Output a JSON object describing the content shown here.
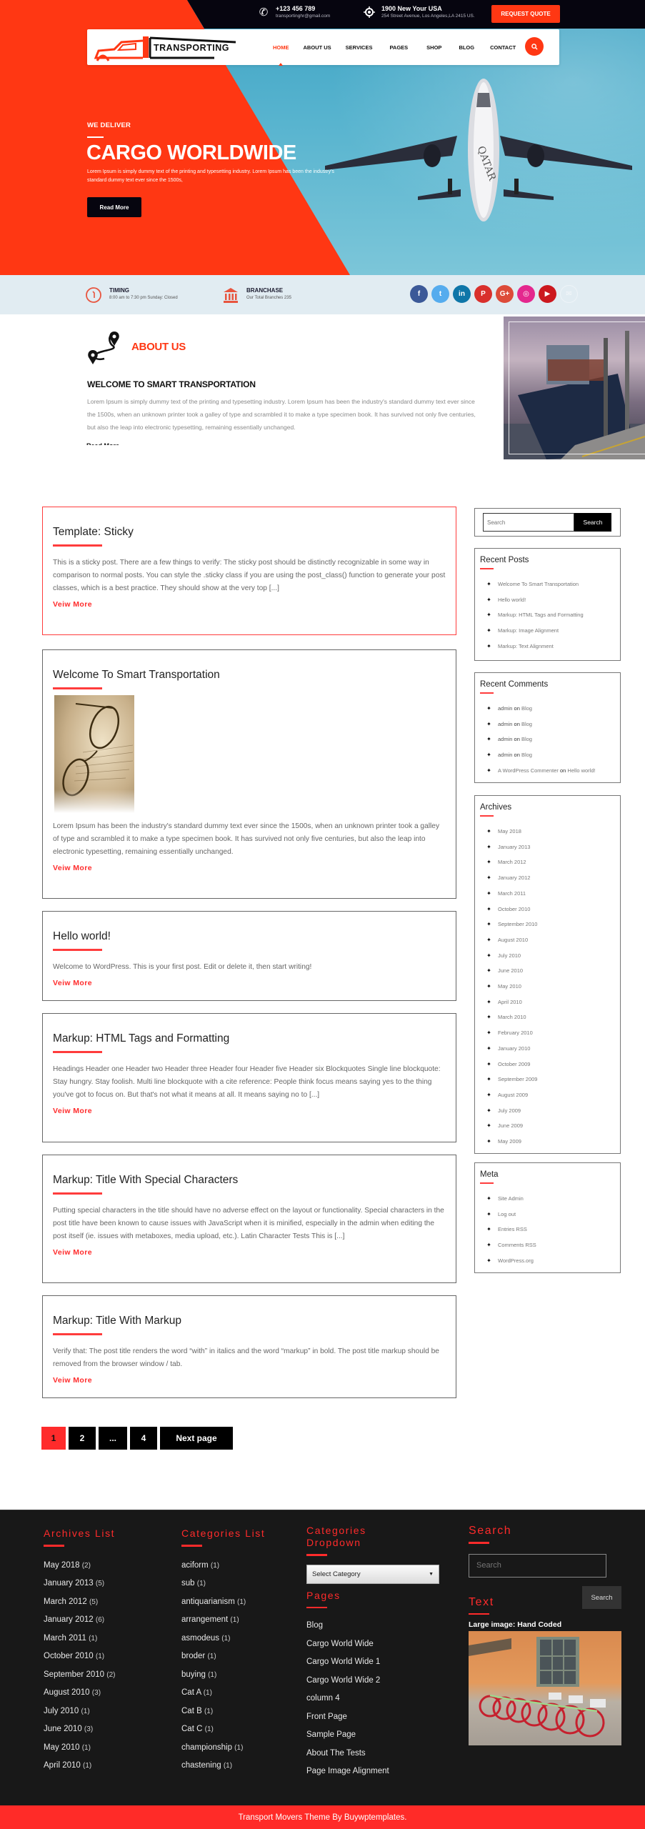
{
  "topbar": {
    "phone": "+123 456 789",
    "email": "transportinghr@gmail.com",
    "address_title": "1900 New Your USA",
    "address_line": "254 Street Avenue, Los Angeles,LA 2415 US.",
    "quote_button": "REQUEST QUOTE"
  },
  "brand": {
    "name": "TRANSPORTING"
  },
  "nav": {
    "items": [
      {
        "label": "HOME",
        "active": true
      },
      {
        "label": "ABOUT US"
      },
      {
        "label": "SERVICES"
      },
      {
        "label": "PAGES"
      },
      {
        "label": "SHOP"
      },
      {
        "label": "BLOG"
      },
      {
        "label": "CONTACT"
      }
    ]
  },
  "hero": {
    "tag": "WE DELIVER",
    "title": "CARGO WORLDWIDE",
    "description": "Lorem Ipsum is simply dummy text of the printing and typesetting industry. Lorem Ipsum has been the industry's standard dummy text ever since the 1500s,",
    "button": "Read More"
  },
  "info": {
    "timing_title": "TIMING",
    "timing_text": "8:00 am to 7:30 pm  Sunday: Closed",
    "branch_title": "BRANCHASE",
    "branch_text": "Our Total Branches 235",
    "socials": [
      {
        "name": "facebook",
        "glyph": "f",
        "color": "#3b5998"
      },
      {
        "name": "twitter",
        "glyph": "t",
        "color": "#55acee"
      },
      {
        "name": "linkedin",
        "glyph": "in",
        "color": "#0e76a8"
      },
      {
        "name": "pinterest",
        "glyph": "P",
        "color": "#d9302c"
      },
      {
        "name": "google-plus",
        "glyph": "G+",
        "color": "#dd4b39"
      },
      {
        "name": "instagram",
        "glyph": "◎",
        "color": "#e4288e"
      },
      {
        "name": "youtube",
        "glyph": "▶",
        "color": "#cc181e"
      },
      {
        "name": "email",
        "glyph": "✉",
        "color": "#e1ecf2"
      }
    ]
  },
  "about": {
    "title": "ABOUT US",
    "subtitle": "WELCOME TO SMART TRANSPORTATION",
    "text": "Lorem Ipsum is simply dummy text of the printing and typesetting industry. Lorem Ipsum has been the industry's standard dummy text ever since the 1500s, when an unknown printer took a galley of type and scrambled it to make a type specimen book. It has survived not only five centuries, but also the leap into electronic typesetting, remaining essentially unchanged.",
    "more": "Read More →"
  },
  "posts": [
    {
      "title": "Template: Sticky",
      "excerpt": "This is a sticky post. There are a few things to verify: The sticky post should be distinctly recognizable in some way in comparison to normal posts. You can style the .sticky class if you are using the post_class() function to generate your post classes, which is a best practice. They should show at the very top [...]",
      "more": "Veiw More",
      "sticky": true
    },
    {
      "title": "Welcome To Smart Transportation",
      "excerpt": "Lorem Ipsum has been the industry's standard dummy text ever since the 1500s, when an unknown printer took a galley of type and scrambled it to make a type specimen book. It has survived not only five centuries, but also the leap into electronic typesetting, remaining essentially unchanged.",
      "more": "Veiw More",
      "has_thumbnail": true
    },
    {
      "title": "Hello world!",
      "excerpt": "Welcome to WordPress. This is your first post. Edit or delete it, then start writing!",
      "more": "Veiw More"
    },
    {
      "title": "Markup: HTML Tags and Formatting",
      "excerpt": "Headings Header one Header two Header three Header four Header five Header six Blockquotes Single line blockquote: Stay hungry. Stay foolish. Multi line blockquote with a cite reference: People think focus means saying yes to the thing you've got to focus on. But that's not what it means at all. It means saying no to [...]",
      "more": "Veiw More"
    },
    {
      "title": "Markup: Title With Special Characters",
      "excerpt": "Putting special characters in the title should have no adverse effect on the layout or functionality. Special characters in the post title have been known to cause issues with JavaScript when it is minified, especially in the admin when editing the post itself (ie. issues with metaboxes, media upload, etc.). Latin Character Tests This is [...]",
      "more": "Veiw More"
    },
    {
      "title": "Markup: Title With Markup",
      "excerpt": "Verify that: The post title renders the word “with” in italics and the word “markup” in bold. The post title markup should be removed from the browser window / tab.",
      "more": "Veiw More"
    }
  ],
  "pagination": {
    "pages": [
      "1",
      "2",
      "...",
      "4"
    ],
    "current": "1",
    "next": "Next page"
  },
  "sidebar": {
    "search_placeholder": "Search",
    "search_button": "Search",
    "recent_posts": {
      "title": "Recent Posts",
      "items": [
        "Welcome To Smart Transportation",
        "Hello world!",
        "Markup: HTML Tags and Formatting",
        "Markup: Image Alignment",
        "Markup: Text Alignment"
      ]
    },
    "recent_comments": {
      "title": "Recent Comments",
      "items": [
        {
          "author": "admin",
          "on": "on",
          "post": "Blog"
        },
        {
          "author": "admin",
          "on": "on",
          "post": "Blog"
        },
        {
          "author": "admin",
          "on": "on",
          "post": "Blog"
        },
        {
          "author": "admin",
          "on": "on",
          "post": "Blog"
        },
        {
          "author": "A WordPress Commenter",
          "on": "on",
          "post": "Hello world!"
        }
      ]
    },
    "archives": {
      "title": "Archives",
      "items": [
        "May 2018",
        "January 2013",
        "March 2012",
        "January 2012",
        "March 2011",
        "October 2010",
        "September 2010",
        "August 2010",
        "July 2010",
        "June 2010",
        "May 2010",
        "April 2010",
        "March 2010",
        "February 2010",
        "January 2010",
        "October 2009",
        "September 2009",
        "August 2009",
        "July 2009",
        "June 2009",
        "May 2009"
      ]
    },
    "meta": {
      "title": "Meta",
      "items": [
        "Site Admin",
        "Log out",
        "Entries RSS",
        "Comments RSS",
        "WordPress.org"
      ]
    }
  },
  "footer": {
    "archives": {
      "title": "Archives List",
      "items": [
        {
          "label": "May 2018",
          "count": "(2)"
        },
        {
          "label": "January 2013",
          "count": "(5)"
        },
        {
          "label": "March 2012",
          "count": "(5)"
        },
        {
          "label": "January 2012",
          "count": "(6)"
        },
        {
          "label": "March 2011",
          "count": "(1)"
        },
        {
          "label": "October 2010",
          "count": "(1)"
        },
        {
          "label": "September 2010",
          "count": "(2)"
        },
        {
          "label": "August 2010",
          "count": "(3)"
        },
        {
          "label": "July 2010",
          "count": "(1)"
        },
        {
          "label": "June 2010",
          "count": "(3)"
        },
        {
          "label": "May 2010",
          "count": "(1)"
        },
        {
          "label": "April 2010",
          "count": "(1)"
        }
      ]
    },
    "categories": {
      "title": "Categories List",
      "items": [
        {
          "label": "aciform",
          "count": "(1)"
        },
        {
          "label": "sub",
          "count": "(1)"
        },
        {
          "label": "antiquarianism",
          "count": "(1)"
        },
        {
          "label": "arrangement",
          "count": "(1)"
        },
        {
          "label": "asmodeus",
          "count": "(1)"
        },
        {
          "label": "broder",
          "count": "(1)"
        },
        {
          "label": "buying",
          "count": "(1)"
        },
        {
          "label": "Cat A",
          "count": "(1)"
        },
        {
          "label": "Cat B",
          "count": "(1)"
        },
        {
          "label": "Cat C",
          "count": "(1)"
        },
        {
          "label": "championship",
          "count": "(1)"
        },
        {
          "label": "chastening",
          "count": "(1)"
        }
      ]
    },
    "dropdown": {
      "title_line1": "Categories",
      "title_line2": "Dropdown",
      "selected": "Select Category"
    },
    "pages": {
      "title": "Pages",
      "items": [
        "Blog",
        "Cargo World Wide",
        "Cargo World Wide 1",
        "Cargo World Wide 2",
        "column 4",
        "Front Page",
        "Sample Page",
        "About The Tests",
        "Page Image Alignment"
      ]
    },
    "search": {
      "title": "Search",
      "placeholder": "Search",
      "button": "Search"
    },
    "text": {
      "title": "Text",
      "image_caption": "Large image: Hand Coded"
    }
  },
  "copyright": "Transport Movers Theme By Buywptemplates.",
  "colors": {
    "accent": "#ff3713",
    "dark": "#06050f",
    "footer_bg": "#181818",
    "copyright_bg": "#ff2b28"
  }
}
